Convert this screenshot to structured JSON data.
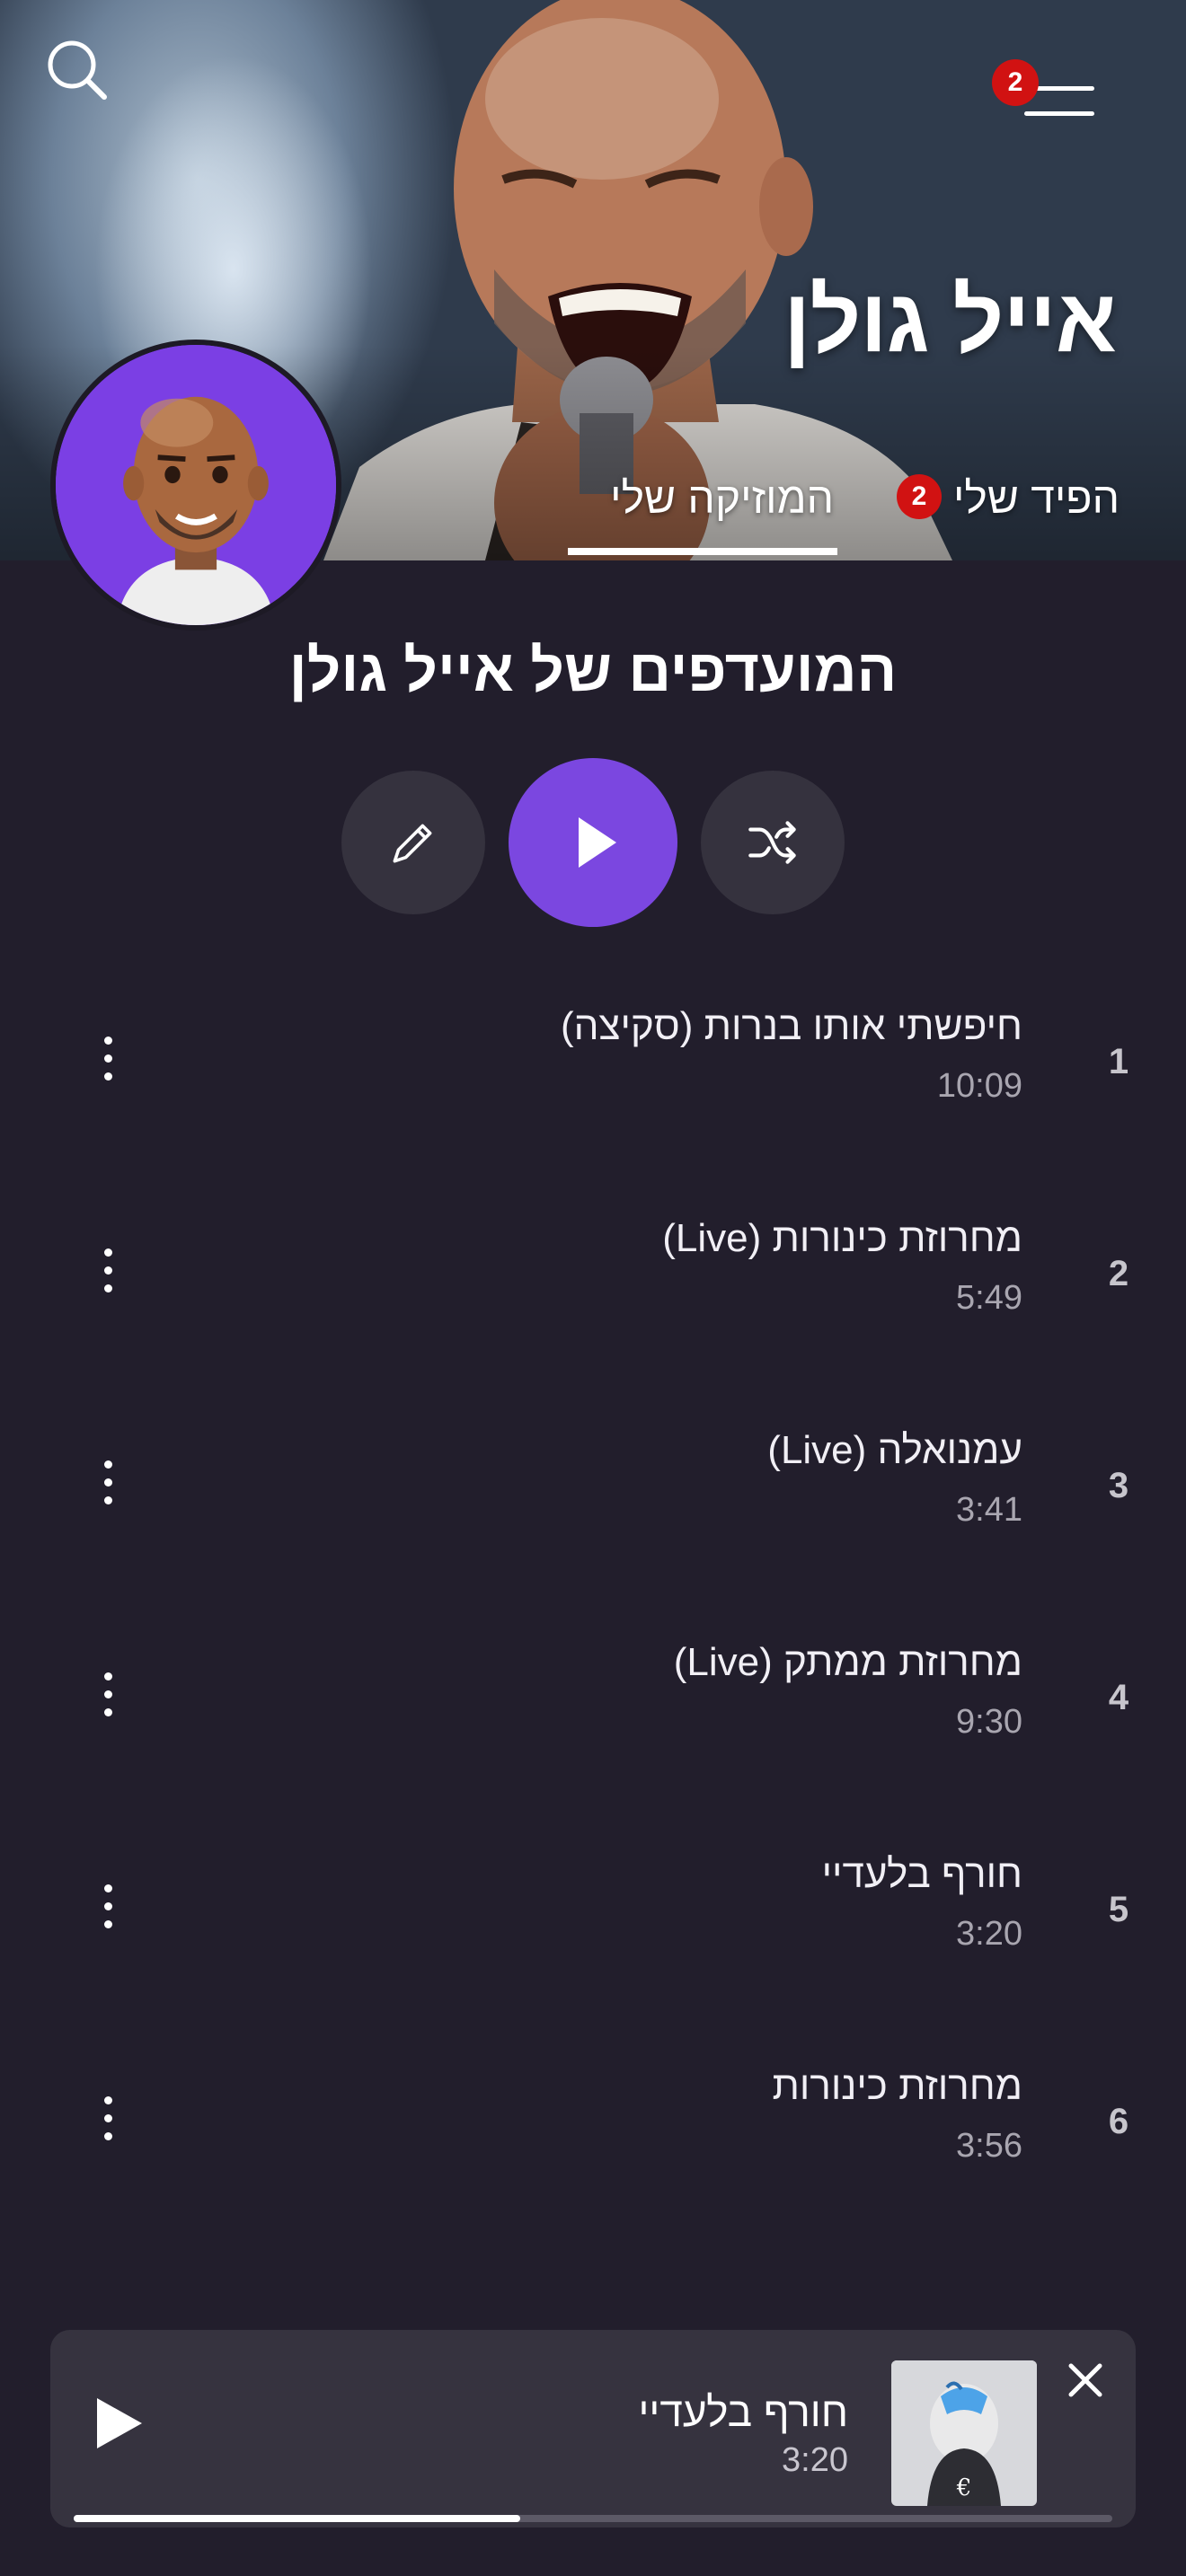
{
  "header": {
    "artist_name": "אייל גולן",
    "menu_badge": "2",
    "tabs": [
      {
        "label": "הפיד שלי",
        "badge": "2",
        "selected": false
      },
      {
        "label": "המוזיקה שלי",
        "selected": true
      }
    ],
    "icons": {
      "search": "search-icon",
      "menu": "hamburger-menu-icon"
    }
  },
  "playlist": {
    "title": "המועדפים של אייל גולן",
    "controls": {
      "edit": "pencil-icon",
      "play": "play-icon",
      "shuffle": "shuffle-icon"
    },
    "tracks": [
      {
        "number": "1",
        "title": "חיפשתי אותו בנרות (סקיצה)",
        "duration": "10:09"
      },
      {
        "number": "2",
        "title": "מחרוזת כינורות (Live)",
        "duration": "5:49"
      },
      {
        "number": "3",
        "title": "עמנואלה (Live)",
        "duration": "3:41"
      },
      {
        "number": "4",
        "title": "מחרוזת ממתק (Live)",
        "duration": "9:30"
      },
      {
        "number": "5",
        "title": "חורף בלעדיי",
        "duration": "3:20"
      },
      {
        "number": "6",
        "title": "מחרוזת כינורות",
        "duration": "3:56"
      }
    ]
  },
  "now_playing": {
    "title": "חורף בלעדיי",
    "duration": "3:20",
    "progress": 0.43
  },
  "colors": {
    "background": "#221e2c",
    "accent": "#7b47e0",
    "badge": "#d11212",
    "control_bg": "#35323e"
  }
}
